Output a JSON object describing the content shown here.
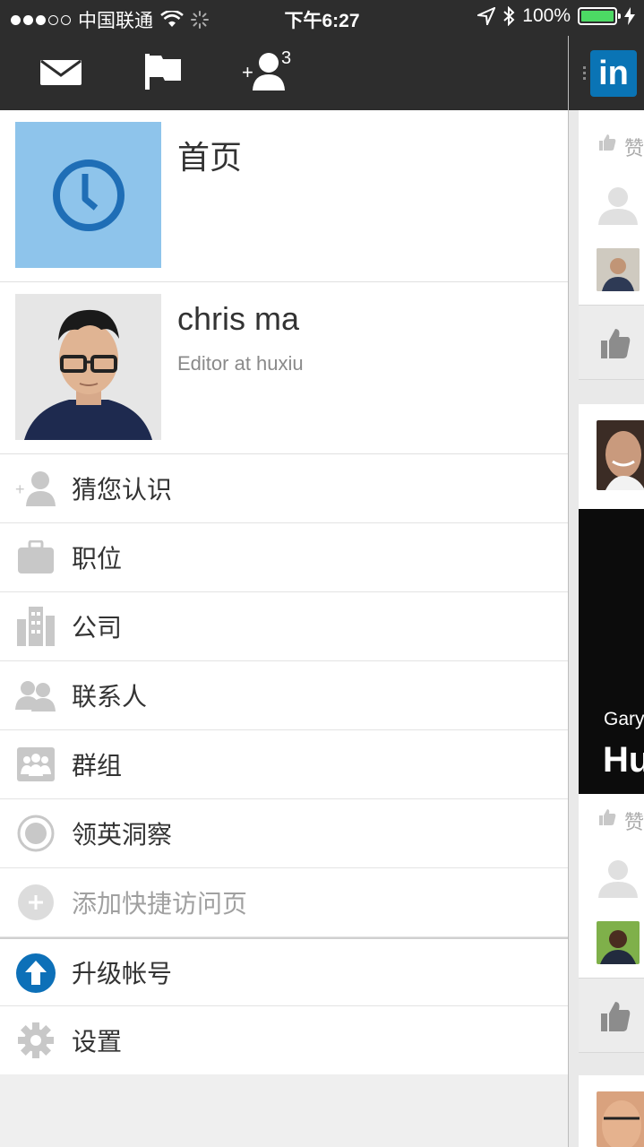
{
  "status_bar": {
    "carrier": "中国联通",
    "time": "下午6:27",
    "battery": "100%"
  },
  "toolbar": {
    "connection_badge": "3"
  },
  "home": {
    "title": "首页"
  },
  "profile": {
    "name": "chris ma",
    "headline": "Editor at huxiu"
  },
  "menu": [
    {
      "label": "猜您认识",
      "icon": "add-person-icon"
    },
    {
      "label": "职位",
      "icon": "briefcase-icon"
    },
    {
      "label": "公司",
      "icon": "building-icon"
    },
    {
      "label": "联系人",
      "icon": "contacts-icon"
    },
    {
      "label": "群组",
      "icon": "group-icon"
    },
    {
      "label": "领英洞察",
      "icon": "pulse-icon"
    },
    {
      "label": "添加快捷访问页",
      "icon": "plus-circle-icon"
    },
    {
      "label": "升级帐号",
      "icon": "upgrade-arrow-icon"
    },
    {
      "label": "设置",
      "icon": "gear-icon"
    }
  ],
  "feed_peek": {
    "logo": "in",
    "like_label": "赞",
    "video_caption_small": "Gary",
    "video_caption_big": "Hu"
  },
  "colors": {
    "dark_bar": "#2d2d2d",
    "linkedin_blue": "#0a74b5",
    "home_tile": "#8ec4eb",
    "upgrade_blue": "#0d70b8"
  }
}
